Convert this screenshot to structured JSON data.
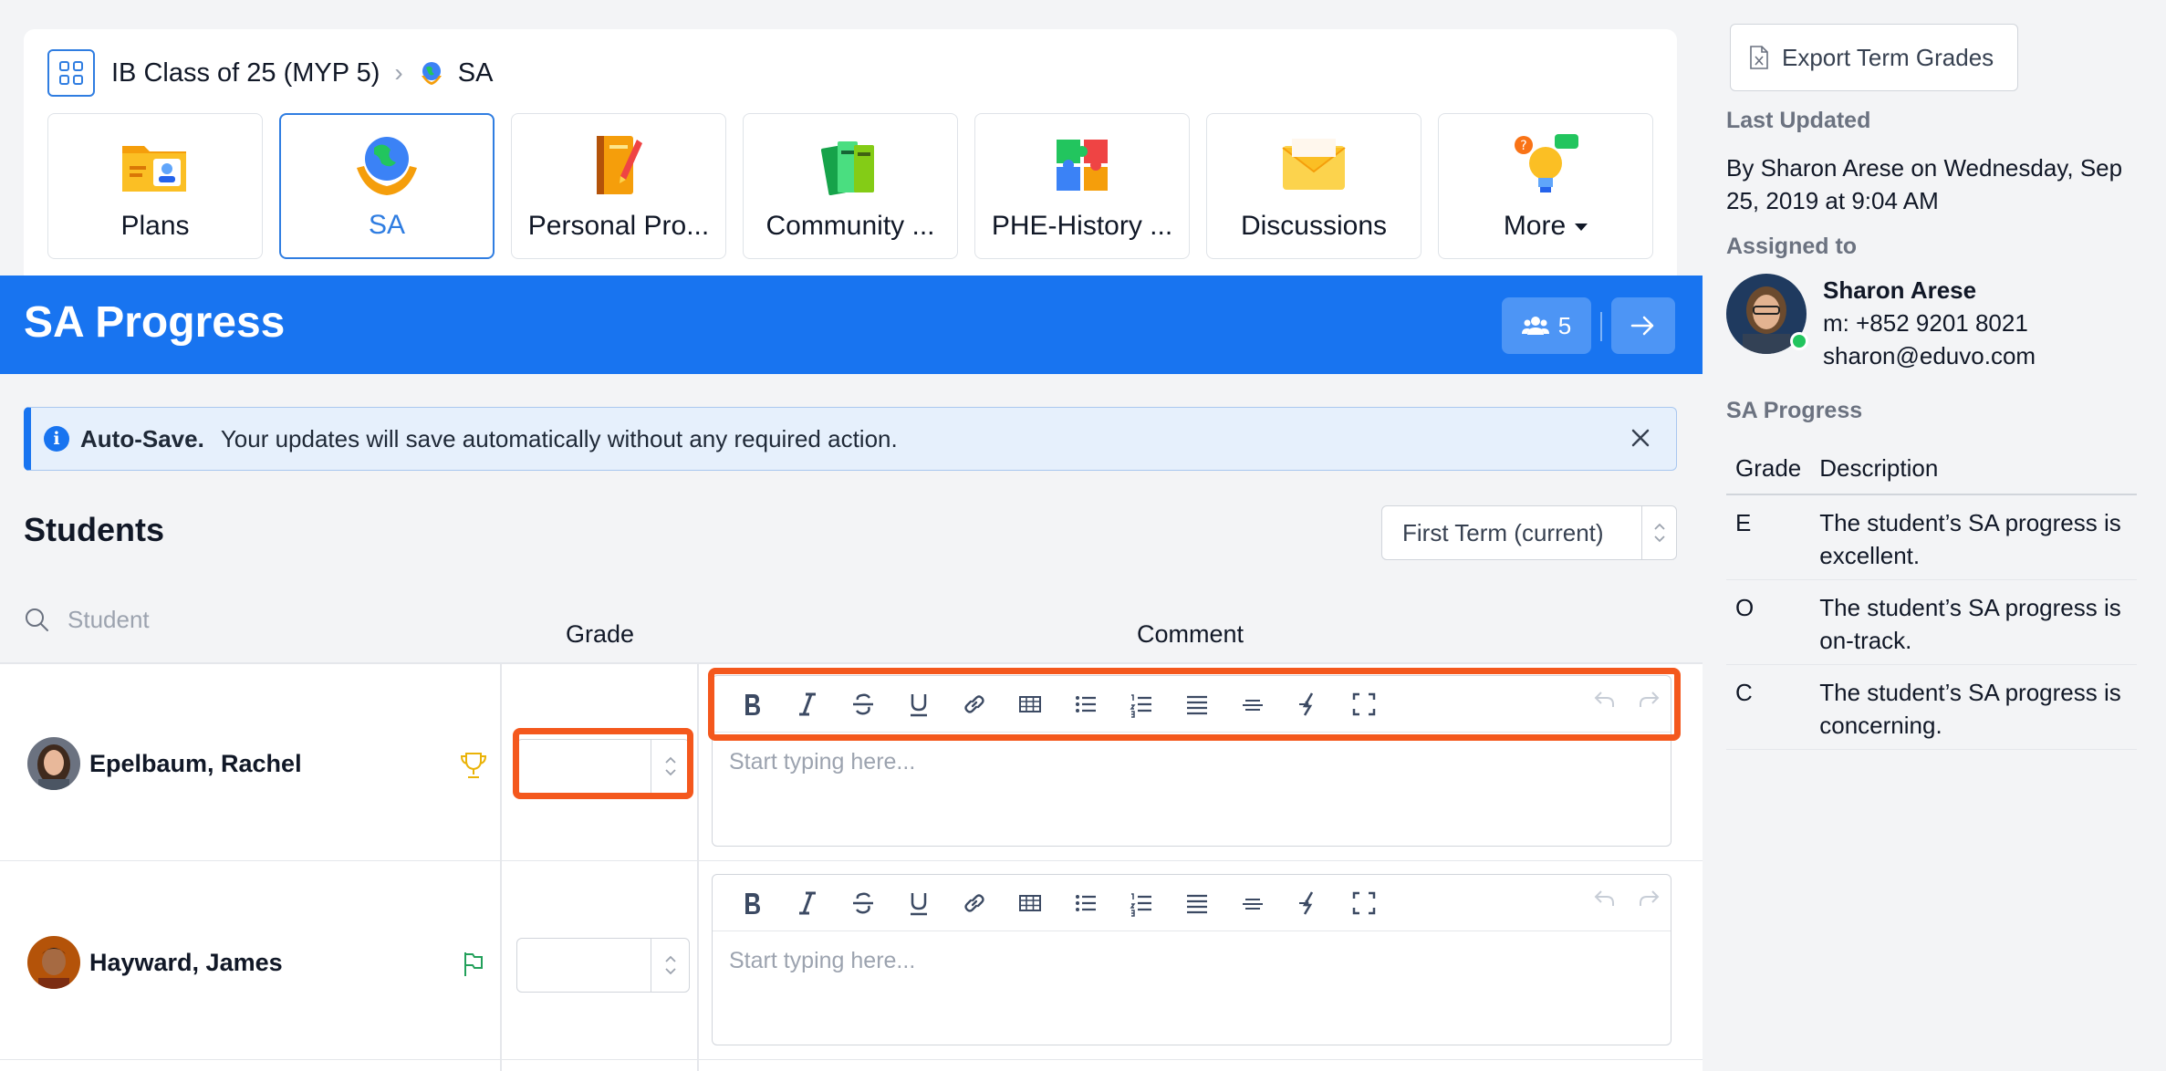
{
  "breadcrumb": {
    "parent": "IB Class of 25 (MYP 5)",
    "current": "SA"
  },
  "tiles": [
    {
      "label": "Plans",
      "icon": "folder-profile-icon"
    },
    {
      "label": "SA",
      "icon": "globe-hands-icon",
      "active": true
    },
    {
      "label": "Personal Pro...",
      "icon": "notebook-pencil-icon"
    },
    {
      "label": "Community ...",
      "icon": "books-icon"
    },
    {
      "label": "PHE-History ...",
      "icon": "puzzle-icon"
    },
    {
      "label": "Discussions",
      "icon": "envelope-icon"
    },
    {
      "label": "More",
      "icon": "lightbulb-chat-icon"
    }
  ],
  "header": {
    "title": "SA Progress",
    "member_count": "5"
  },
  "alert": {
    "title": "Auto-Save.",
    "message": "Your updates will save automatically without any required action."
  },
  "students": {
    "title": "Students",
    "term": "First Term (current)",
    "search_placeholder": "Student",
    "grade_header": "Grade",
    "comment_header": "Comment",
    "rows": [
      {
        "name": "Epelbaum, Rachel",
        "status_icon": "trophy-icon",
        "comment_placeholder": "Start typing here..."
      },
      {
        "name": "Hayward, James",
        "status_icon": "flag-icon",
        "comment_placeholder": "Start typing here..."
      }
    ]
  },
  "side": {
    "export_label": "Export Term Grades",
    "last_updated_label": "Last Updated",
    "last_updated_text": "By Sharon Arese on Wednesday, Sep 25, 2019 at 9:04 AM",
    "assigned_label": "Assigned to",
    "assignee": {
      "name": "Sharon Arese",
      "phone": "m: +852 9201 8021",
      "email": "sharon@eduvo.com"
    },
    "progress_label": "SA Progress",
    "grade_col": "Grade",
    "desc_col": "Description",
    "grades": [
      {
        "grade": "E",
        "description": "The student’s SA progress is excellent."
      },
      {
        "grade": "O",
        "description": "The student’s SA progress is on-track."
      },
      {
        "grade": "C",
        "description": "The student’s SA progress is concerning."
      }
    ]
  },
  "colors": {
    "brand_blue": "#1874f0",
    "highlight": "#f4581d",
    "online": "#22c55e"
  }
}
